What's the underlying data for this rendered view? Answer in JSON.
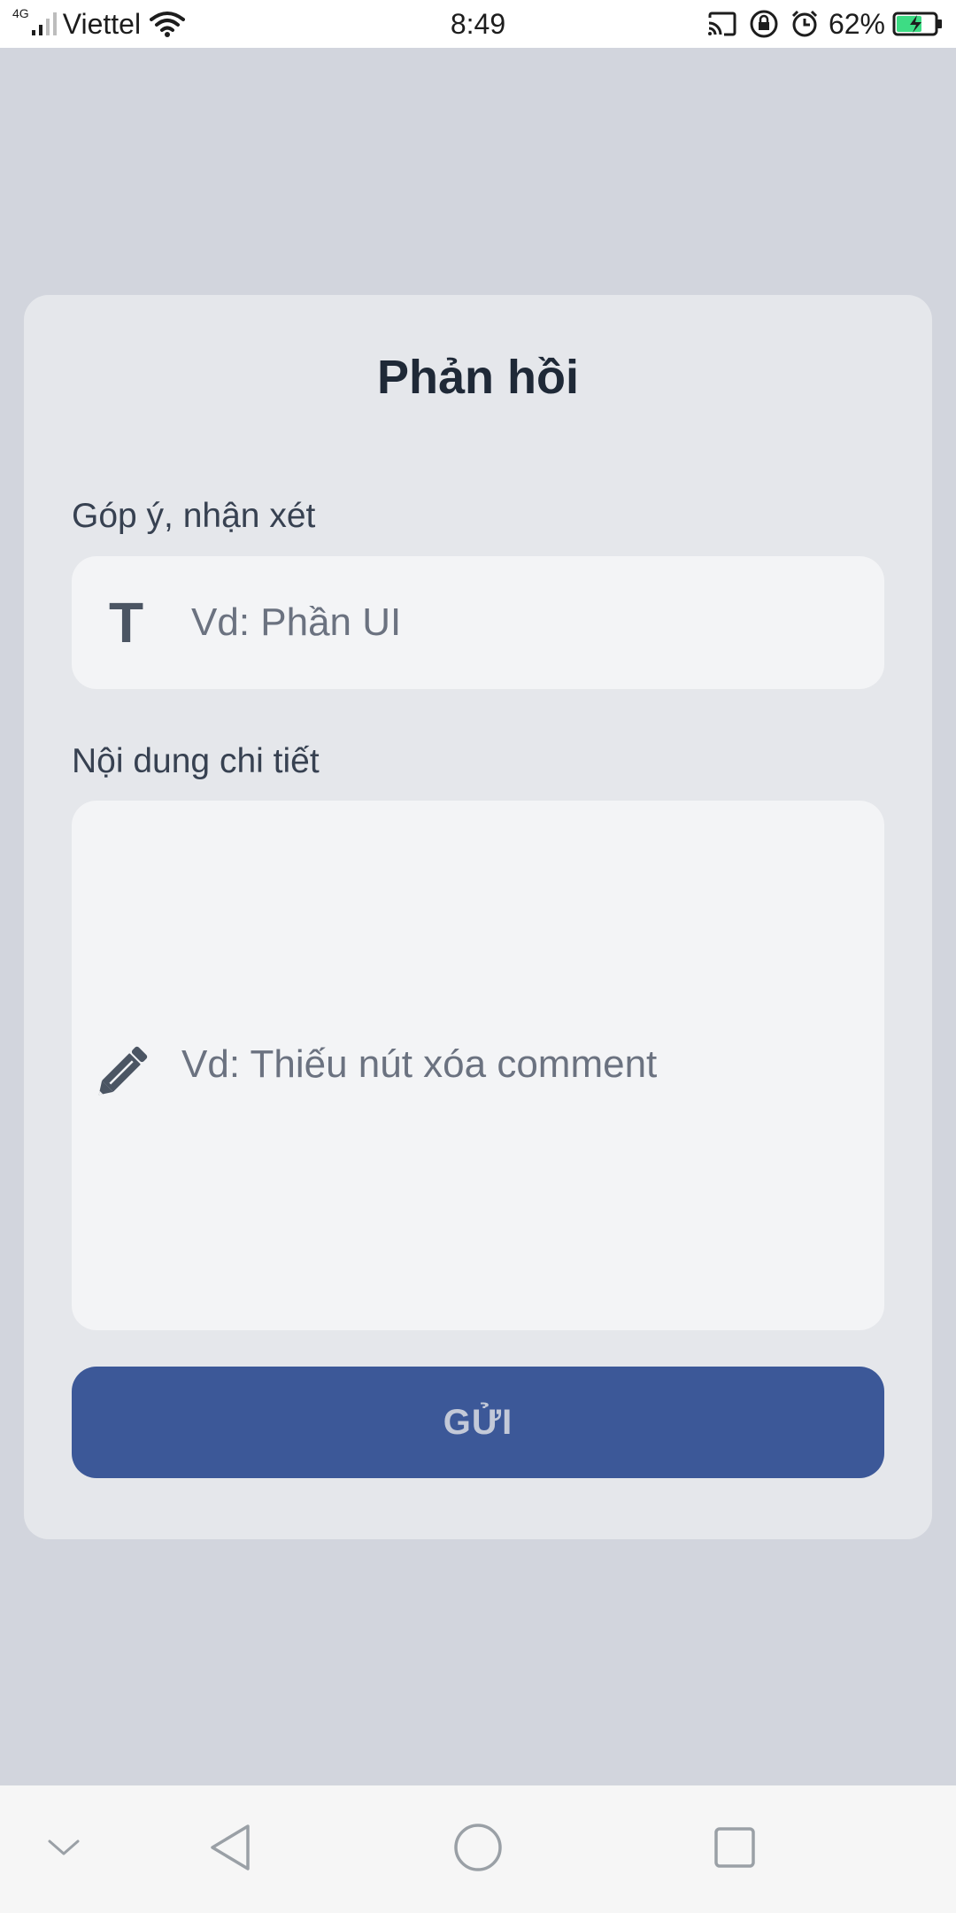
{
  "status_bar": {
    "network_type": "4G",
    "carrier": "Viettel",
    "time": "8:49",
    "battery_percent": "62%",
    "icons": [
      "signal-icon",
      "wifi-icon",
      "cast-icon",
      "rotation-lock-icon",
      "alarm-icon",
      "battery-charging-icon"
    ]
  },
  "feedback_form": {
    "title": "Phản hồi",
    "feedback_field": {
      "label": "Góp ý, nhận xét",
      "placeholder": "Vd: Phần UI",
      "value": "",
      "icon": "text-icon",
      "icon_glyph": "T"
    },
    "detail_field": {
      "label": "Nội dung chi tiết",
      "placeholder": "Vd: Thiếu nút xóa comment",
      "value": "",
      "icon": "pencil-icon"
    },
    "submit_label": "GỬI"
  },
  "nav_bar": {
    "buttons": [
      "collapse-icon",
      "back-icon",
      "home-icon",
      "recent-apps-icon"
    ]
  },
  "colors": {
    "page_background": "#d2d5dd",
    "card_background": "#e5e7eb",
    "input_background": "#f3f4f6",
    "button_background": "#3c5898",
    "button_text": "#c3c9d8",
    "title_text": "#1f2937",
    "placeholder_text": "#6b7280"
  }
}
